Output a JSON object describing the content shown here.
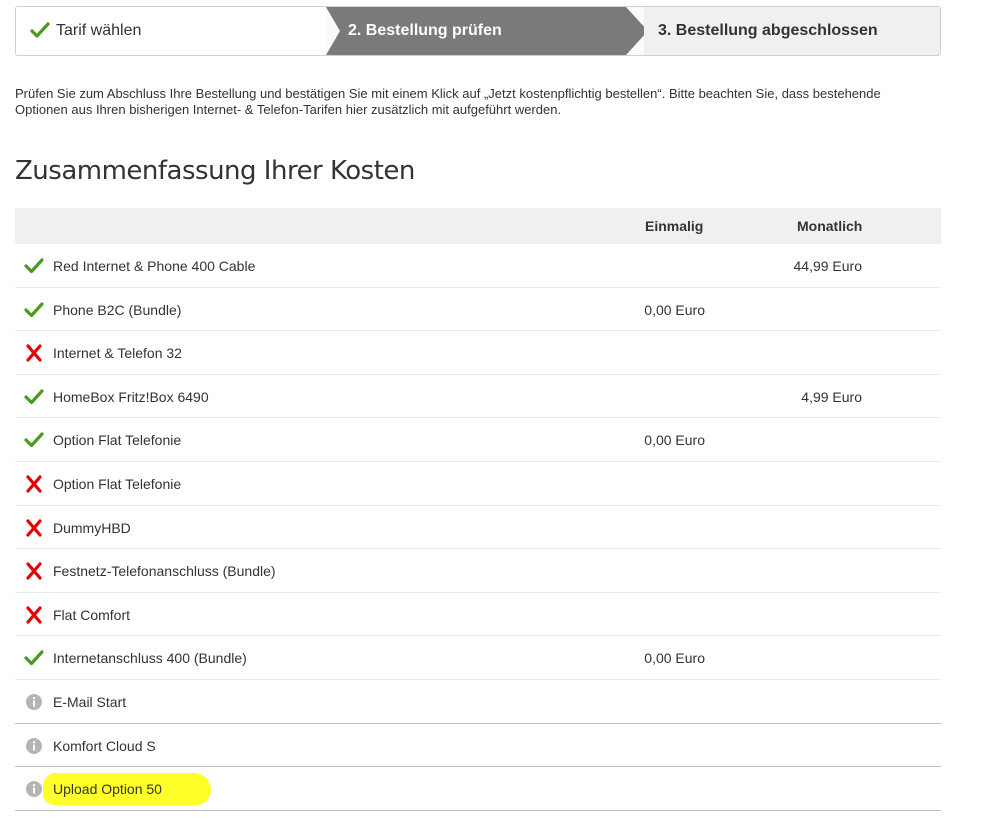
{
  "stepper": {
    "step1": "Tarif wählen",
    "step2": "2. Bestellung prüfen",
    "step3": "3. Bestellung abgeschlossen"
  },
  "intro": "Prüfen Sie zum Abschluss Ihre Bestellung und bestätigen Sie mit einem Klick auf „Jetzt kostenpflichtig bestellen“. Bitte beachten Sie, dass bestehende Optionen aus Ihren bisherigen Internet- & Telefon-Tarifen hier zusätzlich mit aufgeführt werden.",
  "heading": "Zusammenfassung Ihrer Kosten",
  "table": {
    "col_once": "Einmalig",
    "col_month": "Monatlich",
    "rows": [
      {
        "status": "check",
        "label": "Red Internet & Phone 400 Cable",
        "once": "",
        "month": "44,99 Euro"
      },
      {
        "status": "check",
        "label": "Phone B2C (Bundle)",
        "once": "0,00 Euro",
        "month": ""
      },
      {
        "status": "cross",
        "label": "Internet & Telefon 32",
        "once": "",
        "month": ""
      },
      {
        "status": "check",
        "label": "HomeBox Fritz!Box 6490",
        "once": "",
        "month": "4,99 Euro"
      },
      {
        "status": "check",
        "label": "Option Flat Telefonie",
        "once": "0,00 Euro",
        "month": ""
      },
      {
        "status": "cross",
        "label": "Option Flat Telefonie",
        "once": "",
        "month": ""
      },
      {
        "status": "cross",
        "label": "DummyHBD",
        "once": "",
        "month": ""
      },
      {
        "status": "cross",
        "label": "Festnetz-Telefonanschluss (Bundle)",
        "once": "",
        "month": ""
      },
      {
        "status": "cross",
        "label": "Flat Comfort",
        "once": "",
        "month": ""
      },
      {
        "status": "check",
        "label": "Internetanschluss 400 (Bundle)",
        "once": "0,00 Euro",
        "month": ""
      },
      {
        "status": "info",
        "label": "E-Mail Start",
        "once": "",
        "month": ""
      },
      {
        "status": "info",
        "label": "Komfort Cloud S",
        "once": "",
        "month": ""
      },
      {
        "status": "info",
        "label": "Upload Option 50",
        "once": "",
        "month": "",
        "highlight": true
      }
    ]
  },
  "colors": {
    "check": "#4a9a1f",
    "cross": "#e60000",
    "info": "#b5b5b5",
    "active_step": "#7a7a7a",
    "highlight": "#ffff00"
  }
}
